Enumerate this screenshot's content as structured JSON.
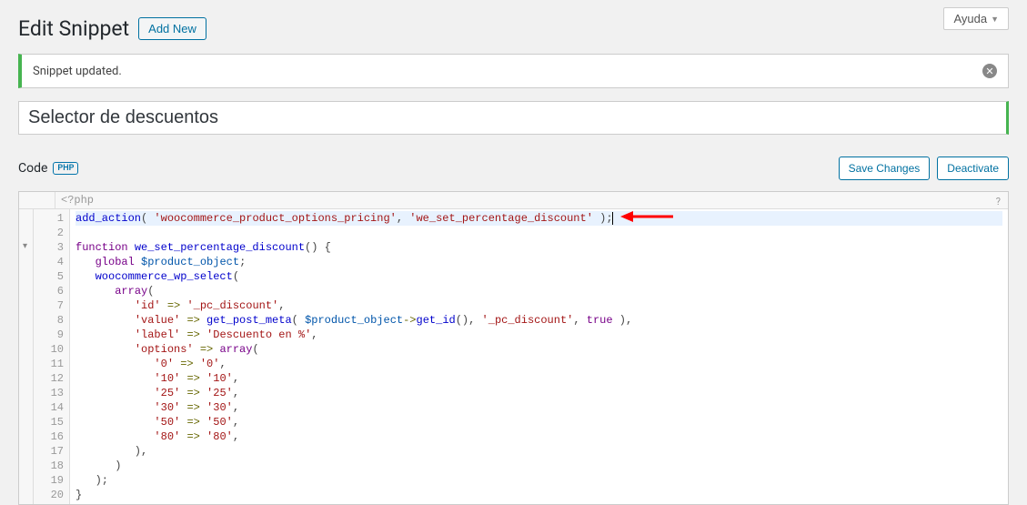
{
  "header": {
    "title": "Edit Snippet",
    "add_new": "Add New",
    "help": "Ayuda"
  },
  "notice": {
    "message": "Snippet updated."
  },
  "snippet": {
    "title": "Selector de descuentos"
  },
  "section": {
    "code_label": "Code",
    "badge": "PHP"
  },
  "buttons": {
    "save": "Save Changes",
    "deactivate": "Deactivate"
  },
  "editor": {
    "open_tag": "<?php",
    "lines": [
      {
        "n": 1,
        "tokens": [
          [
            "fn",
            "add_action"
          ],
          [
            "pn",
            "( "
          ],
          [
            "str",
            "'woocommerce_product_options_pricing'"
          ],
          [
            "pn",
            ", "
          ],
          [
            "str",
            "'we_set_percentage_discount'"
          ],
          [
            "pn",
            " );"
          ]
        ]
      },
      {
        "n": 2,
        "tokens": []
      },
      {
        "n": 3,
        "fold": true,
        "tokens": [
          [
            "kw",
            "function"
          ],
          [
            "pn",
            " "
          ],
          [
            "fn",
            "we_set_percentage_discount"
          ],
          [
            "pn",
            "() {"
          ]
        ]
      },
      {
        "n": 4,
        "tokens": [
          [
            "pn",
            "   "
          ],
          [
            "kw",
            "global"
          ],
          [
            "pn",
            " "
          ],
          [
            "var",
            "$product_object"
          ],
          [
            "pn",
            ";"
          ]
        ]
      },
      {
        "n": 5,
        "tokens": [
          [
            "pn",
            "   "
          ],
          [
            "fn",
            "woocommerce_wp_select"
          ],
          [
            "pn",
            "("
          ]
        ]
      },
      {
        "n": 6,
        "tokens": [
          [
            "pn",
            "      "
          ],
          [
            "kw",
            "array"
          ],
          [
            "pn",
            "("
          ]
        ]
      },
      {
        "n": 7,
        "tokens": [
          [
            "pn",
            "         "
          ],
          [
            "str",
            "'id'"
          ],
          [
            "pn",
            " "
          ],
          [
            "op",
            "=>"
          ],
          [
            "pn",
            " "
          ],
          [
            "str",
            "'_pc_discount'"
          ],
          [
            "pn",
            ","
          ]
        ]
      },
      {
        "n": 8,
        "tokens": [
          [
            "pn",
            "         "
          ],
          [
            "str",
            "'value'"
          ],
          [
            "pn",
            " "
          ],
          [
            "op",
            "=>"
          ],
          [
            "pn",
            " "
          ],
          [
            "fn",
            "get_post_meta"
          ],
          [
            "pn",
            "( "
          ],
          [
            "var",
            "$product_object"
          ],
          [
            "op",
            "->"
          ],
          [
            "fn",
            "get_id"
          ],
          [
            "pn",
            "(), "
          ],
          [
            "str",
            "'_pc_discount'"
          ],
          [
            "pn",
            ", "
          ],
          [
            "kw",
            "true"
          ],
          [
            "pn",
            " ),"
          ]
        ]
      },
      {
        "n": 9,
        "tokens": [
          [
            "pn",
            "         "
          ],
          [
            "str",
            "'label'"
          ],
          [
            "pn",
            " "
          ],
          [
            "op",
            "=>"
          ],
          [
            "pn",
            " "
          ],
          [
            "str",
            "'Descuento en %'"
          ],
          [
            "pn",
            ","
          ]
        ]
      },
      {
        "n": 10,
        "tokens": [
          [
            "pn",
            "         "
          ],
          [
            "str",
            "'options'"
          ],
          [
            "pn",
            " "
          ],
          [
            "op",
            "=>"
          ],
          [
            "pn",
            " "
          ],
          [
            "kw",
            "array"
          ],
          [
            "pn",
            "("
          ]
        ]
      },
      {
        "n": 11,
        "tokens": [
          [
            "pn",
            "            "
          ],
          [
            "str",
            "'0'"
          ],
          [
            "pn",
            " "
          ],
          [
            "op",
            "=>"
          ],
          [
            "pn",
            " "
          ],
          [
            "str",
            "'0'"
          ],
          [
            "pn",
            ","
          ]
        ]
      },
      {
        "n": 12,
        "tokens": [
          [
            "pn",
            "            "
          ],
          [
            "str",
            "'10'"
          ],
          [
            "pn",
            " "
          ],
          [
            "op",
            "=>"
          ],
          [
            "pn",
            " "
          ],
          [
            "str",
            "'10'"
          ],
          [
            "pn",
            ","
          ]
        ]
      },
      {
        "n": 13,
        "tokens": [
          [
            "pn",
            "            "
          ],
          [
            "str",
            "'25'"
          ],
          [
            "pn",
            " "
          ],
          [
            "op",
            "=>"
          ],
          [
            "pn",
            " "
          ],
          [
            "str",
            "'25'"
          ],
          [
            "pn",
            ","
          ]
        ]
      },
      {
        "n": 14,
        "tokens": [
          [
            "pn",
            "            "
          ],
          [
            "str",
            "'30'"
          ],
          [
            "pn",
            " "
          ],
          [
            "op",
            "=>"
          ],
          [
            "pn",
            " "
          ],
          [
            "str",
            "'30'"
          ],
          [
            "pn",
            ","
          ]
        ]
      },
      {
        "n": 15,
        "tokens": [
          [
            "pn",
            "            "
          ],
          [
            "str",
            "'50'"
          ],
          [
            "pn",
            " "
          ],
          [
            "op",
            "=>"
          ],
          [
            "pn",
            " "
          ],
          [
            "str",
            "'50'"
          ],
          [
            "pn",
            ","
          ]
        ]
      },
      {
        "n": 16,
        "tokens": [
          [
            "pn",
            "            "
          ],
          [
            "str",
            "'80'"
          ],
          [
            "pn",
            " "
          ],
          [
            "op",
            "=>"
          ],
          [
            "pn",
            " "
          ],
          [
            "str",
            "'80'"
          ],
          [
            "pn",
            ","
          ]
        ]
      },
      {
        "n": 17,
        "tokens": [
          [
            "pn",
            "         ),"
          ]
        ]
      },
      {
        "n": 18,
        "tokens": [
          [
            "pn",
            "      )"
          ]
        ]
      },
      {
        "n": 19,
        "tokens": [
          [
            "pn",
            "   );"
          ]
        ]
      },
      {
        "n": 20,
        "tokens": [
          [
            "pn",
            "}"
          ]
        ]
      }
    ]
  }
}
